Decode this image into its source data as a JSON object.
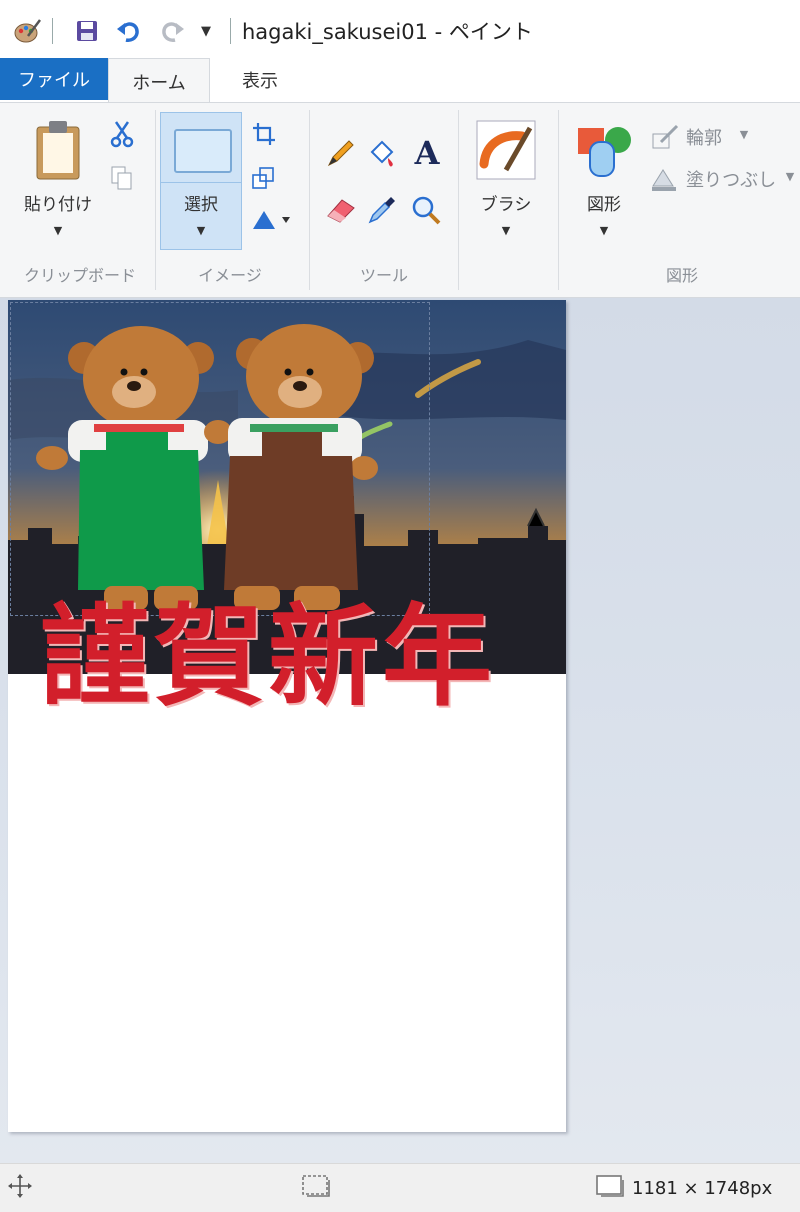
{
  "window": {
    "title": "hagaki_sakusei01 - ペイント"
  },
  "quick_access": {
    "icons": [
      "paint-app-icon",
      "save-icon",
      "undo-icon",
      "redo-icon",
      "customize-dropdown-icon"
    ]
  },
  "tabs": [
    {
      "label": "ファイル",
      "active": false
    },
    {
      "label": "ホーム",
      "active": true
    },
    {
      "label": "表示",
      "active": false
    }
  ],
  "ribbon": {
    "clipboard": {
      "group_label": "クリップボード",
      "paste_label": "貼り付け"
    },
    "image": {
      "group_label": "イメージ",
      "select_label": "選択"
    },
    "tools": {
      "group_label": "ツール"
    },
    "brush": {
      "label": "ブラシ"
    },
    "shapes": {
      "group_label": "図形",
      "shapes_label": "図形",
      "outline_label": "輪郭",
      "fill_label": "塗りつぶし"
    }
  },
  "canvas": {
    "greeting_text": "謹賀新年"
  },
  "statusbar": {
    "dimensions": "1181 × 1748px"
  },
  "colors": {
    "file_tab": "#1a6fc4",
    "ribbon_bg": "#f5f6f7",
    "selected_tool": "#cfe3f6",
    "greeting_red": "#d21f2b",
    "workspace": "#d8dfe9"
  }
}
